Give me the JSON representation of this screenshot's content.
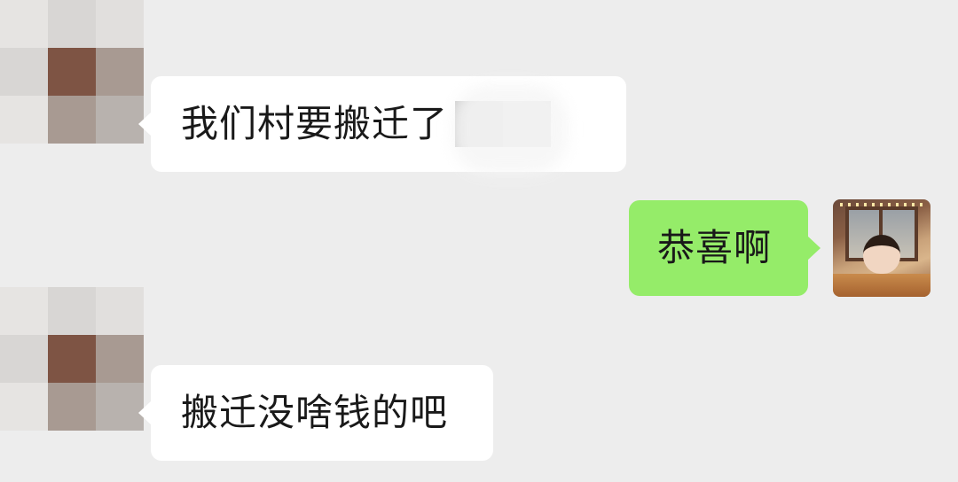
{
  "messages": [
    {
      "sender": "other",
      "text": "我们村要搬迁了",
      "redacted_suffix": true
    },
    {
      "sender": "me",
      "text": "恭喜啊"
    },
    {
      "sender": "other",
      "text": "搬迁没啥钱的吧"
    }
  ],
  "colors": {
    "background": "#ededed",
    "incoming_bubble": "#ffffff",
    "outgoing_bubble": "#95ec69",
    "text": "#191919"
  },
  "icons": {
    "contact_avatar": "pixelated-avatar",
    "my_avatar": "girl-at-window-photo"
  }
}
